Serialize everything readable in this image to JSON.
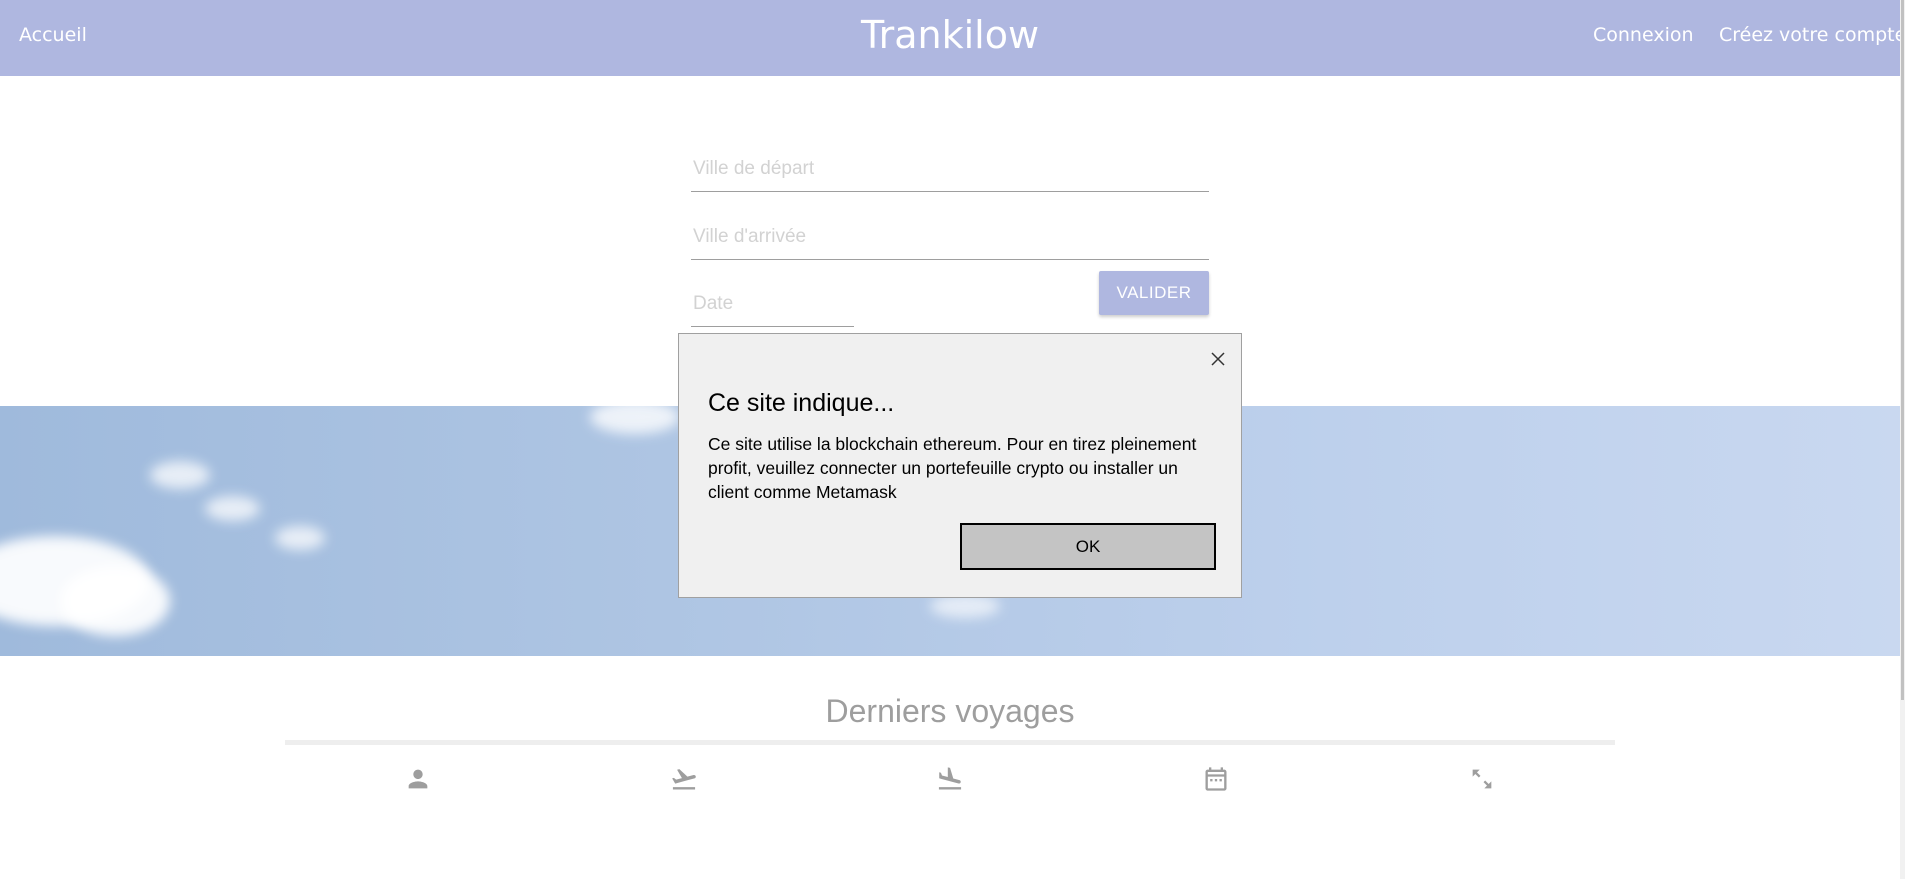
{
  "navbar": {
    "home_label": "Accueil",
    "brand": "Trankilow",
    "login_label": "Connexion",
    "signup_label": "Créez votre compte",
    "color": "#afb7e0"
  },
  "search_form": {
    "depart_placeholder": "Ville de départ",
    "arrivee_placeholder": "Ville d'arrivée",
    "date_placeholder": "Date",
    "submit_label": "VALIDER"
  },
  "trips_section": {
    "title": "Derniers voyages",
    "column_icons": [
      "person-icon",
      "flight-takeoff-icon",
      "flight-land-icon",
      "calendar-icon",
      "expand-icon"
    ]
  },
  "alert_dialog": {
    "title": "Ce site indique...",
    "message": "Ce site utilise la blockchain ethereum. Pour en tirez pleinement profit, veuillez connecter un portefeuille crypto ou installer un client comme Metamask",
    "ok_label": "OK"
  }
}
